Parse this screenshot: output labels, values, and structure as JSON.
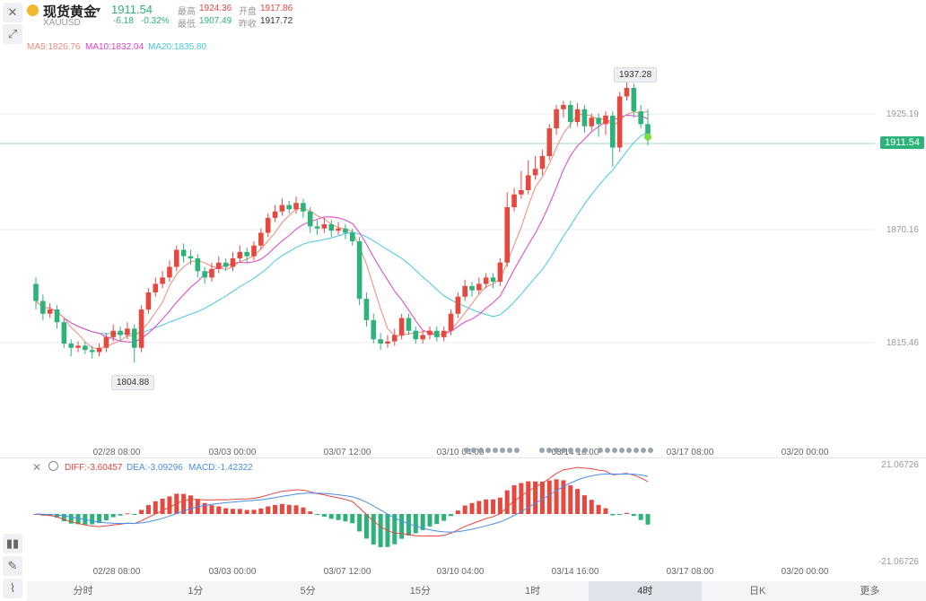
{
  "header": {
    "instrument_name": "现货黄金",
    "dropdown_icon": "caret-down-icon",
    "symbol": "XAUUSD",
    "price": "1911.54",
    "change": "-6.18",
    "change_pct": "-0.32%",
    "high_label": "最高",
    "high": "1924.36",
    "open_label": "开盘",
    "open": "1917.86",
    "low_label": "最低",
    "low": "1907.49",
    "prev_close_label": "昨收",
    "prev_close": "1917.72"
  },
  "ma": {
    "ma5": "MA5:1826.76",
    "ma10": "MA10:1832.04",
    "ma20": "MA20:1835.80"
  },
  "price_axis": [
    "1925.19",
    "1870.16",
    "1815.46"
  ],
  "current_price_tag": "1911.54",
  "high_marker": "1937.28",
  "low_marker": "1804.88",
  "x_axis_main": [
    "02/28 08:00",
    "03/03 00:00",
    "03/07 12:00",
    "03/10 04:00",
    "03/14 16:00",
    "03/17 08:00",
    "03/20 00:00"
  ],
  "x_axis_macd": [
    "02/28 08:00",
    "03/03 00:00",
    "03/07 12:00",
    "03/10 04:00",
    "03/14 16:00",
    "03/17 08:00",
    "03/20 00:00"
  ],
  "macd": {
    "diff": "DIFF:-3.60457",
    "dea": "DEA:-3.09296",
    "macd": "MACD:-1.42322",
    "axis_top": "21.06726",
    "axis_bottom": "-21.06726"
  },
  "tabs": [
    "分时",
    "1分",
    "5分",
    "15分",
    "1时",
    "4时",
    "日K",
    "更多"
  ],
  "active_tab": "4时",
  "colors": {
    "up": "#e5483f",
    "down": "#2db37a",
    "ma5": "#f08a7a",
    "ma10": "#e040c8",
    "ma20": "#45c8e0",
    "diff": "#e5483f",
    "dea": "#4a8ee8"
  },
  "chart_data": {
    "type": "candlestick",
    "candles": [
      [
        1842,
        1834,
        1845,
        1830
      ],
      [
        1834,
        1828,
        1837,
        1825
      ],
      [
        1828,
        1830,
        1833,
        1826
      ],
      [
        1830,
        1824,
        1832,
        1821
      ],
      [
        1824,
        1814,
        1826,
        1812
      ],
      [
        1814,
        1812,
        1816,
        1808
      ],
      [
        1812,
        1813,
        1815,
        1810
      ],
      [
        1813,
        1811,
        1815,
        1809
      ],
      [
        1811,
        1810,
        1813,
        1807
      ],
      [
        1810,
        1812,
        1814,
        1808
      ],
      [
        1812,
        1817,
        1819,
        1810
      ],
      [
        1817,
        1820,
        1823,
        1815
      ],
      [
        1820,
        1818,
        1822,
        1815
      ],
      [
        1818,
        1821,
        1824,
        1816
      ],
      [
        1821,
        1812,
        1823,
        1805
      ],
      [
        1812,
        1830,
        1832,
        1810
      ],
      [
        1830,
        1838,
        1840,
        1828
      ],
      [
        1838,
        1842,
        1845,
        1836
      ],
      [
        1842,
        1845,
        1848,
        1840
      ],
      [
        1845,
        1850,
        1853,
        1843
      ],
      [
        1850,
        1858,
        1860,
        1848
      ],
      [
        1858,
        1855,
        1861,
        1852
      ],
      [
        1855,
        1854,
        1858,
        1851
      ],
      [
        1854,
        1848,
        1856,
        1845
      ],
      [
        1848,
        1845,
        1850,
        1842
      ],
      [
        1845,
        1849,
        1852,
        1843
      ],
      [
        1849,
        1852,
        1855,
        1847
      ],
      [
        1852,
        1850,
        1854,
        1848
      ],
      [
        1850,
        1854,
        1857,
        1848
      ],
      [
        1854,
        1857,
        1860,
        1852
      ],
      [
        1857,
        1855,
        1859,
        1852
      ],
      [
        1855,
        1860,
        1862,
        1853
      ],
      [
        1860,
        1866,
        1868,
        1858
      ],
      [
        1866,
        1873,
        1875,
        1864
      ],
      [
        1873,
        1876,
        1879,
        1871
      ],
      [
        1876,
        1879,
        1882,
        1874
      ],
      [
        1879,
        1877,
        1881,
        1875
      ],
      [
        1877,
        1880,
        1883,
        1875
      ],
      [
        1880,
        1876,
        1882,
        1873
      ],
      [
        1876,
        1869,
        1878,
        1866
      ],
      [
        1869,
        1868,
        1872,
        1865
      ],
      [
        1868,
        1870,
        1873,
        1866
      ],
      [
        1870,
        1867,
        1872,
        1864
      ],
      [
        1867,
        1868,
        1871,
        1865
      ],
      [
        1868,
        1866,
        1870,
        1863
      ],
      [
        1866,
        1862,
        1868,
        1860
      ],
      [
        1862,
        1835,
        1864,
        1832
      ],
      [
        1835,
        1825,
        1838,
        1822
      ],
      [
        1825,
        1816,
        1828,
        1814
      ],
      [
        1816,
        1814,
        1819,
        1811
      ],
      [
        1814,
        1815,
        1818,
        1812
      ],
      [
        1815,
        1818,
        1821,
        1813
      ],
      [
        1818,
        1826,
        1828,
        1816
      ],
      [
        1826,
        1820,
        1828,
        1818
      ],
      [
        1820,
        1816,
        1822,
        1814
      ],
      [
        1816,
        1818,
        1820,
        1814
      ],
      [
        1818,
        1820,
        1822,
        1816
      ],
      [
        1820,
        1817,
        1822,
        1815
      ],
      [
        1817,
        1820,
        1822,
        1815
      ],
      [
        1820,
        1828,
        1830,
        1818
      ],
      [
        1828,
        1836,
        1838,
        1826
      ],
      [
        1836,
        1841,
        1844,
        1834
      ],
      [
        1841,
        1839,
        1843,
        1836
      ],
      [
        1839,
        1842,
        1845,
        1837
      ],
      [
        1842,
        1845,
        1847,
        1840
      ],
      [
        1845,
        1843,
        1847,
        1840
      ],
      [
        1843,
        1852,
        1854,
        1841
      ],
      [
        1852,
        1878,
        1885,
        1850
      ],
      [
        1878,
        1884,
        1887,
        1876
      ],
      [
        1884,
        1886,
        1895,
        1882
      ],
      [
        1886,
        1893,
        1900,
        1884
      ],
      [
        1893,
        1896,
        1902,
        1891
      ],
      [
        1896,
        1902,
        1905,
        1893
      ],
      [
        1902,
        1915,
        1917,
        1900
      ],
      [
        1915,
        1924,
        1926,
        1912
      ],
      [
        1924,
        1926,
        1928,
        1920
      ],
      [
        1926,
        1918,
        1928,
        1915
      ],
      [
        1918,
        1924,
        1927,
        1916
      ],
      [
        1924,
        1916,
        1926,
        1913
      ],
      [
        1916,
        1920,
        1922,
        1914
      ],
      [
        1920,
        1917,
        1922,
        1911
      ],
      [
        1917,
        1921,
        1923,
        1912
      ],
      [
        1921,
        1906,
        1923,
        1897
      ],
      [
        1906,
        1930,
        1932,
        1904
      ],
      [
        1930,
        1934,
        1937,
        1928
      ],
      [
        1934,
        1923,
        1936,
        1920
      ],
      [
        1923,
        1917,
        1926,
        1915
      ],
      [
        1917,
        1911,
        1924,
        1907
      ]
    ],
    "series": [
      {
        "name": "MA5",
        "value": 1826.76
      },
      {
        "name": "MA10",
        "value": 1832.04
      },
      {
        "name": "MA20",
        "value": 1835.8
      }
    ],
    "ylim": [
      1790,
      1950
    ]
  }
}
